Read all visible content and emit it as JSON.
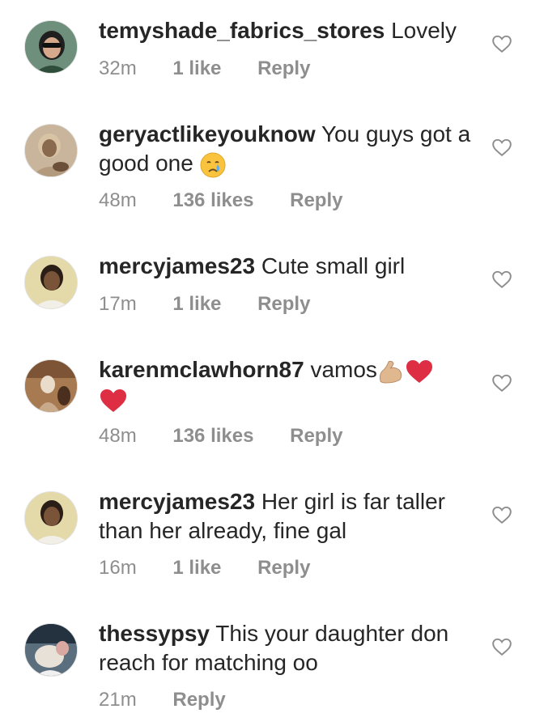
{
  "comments": [
    {
      "username": "temyshade_fabrics_stores",
      "text": "Lovely",
      "time": "32m",
      "likes": "1 like",
      "reply": "Reply",
      "colors": {
        "bg": "#6e8f7b",
        "face": "#d6a98c",
        "hair": "#1f1f1f"
      }
    },
    {
      "username": "geryactlikeyouknow",
      "text": "You guys got a good one",
      "emoji": "crying-face",
      "time": "48m",
      "likes": "136 likes",
      "reply": "Reply",
      "colors": {
        "bg": "#c9b59c",
        "face": "#8a6a4f",
        "hair": "#d8c3a5"
      }
    },
    {
      "username": "mercyjames23",
      "text": "Cute small girl",
      "time": "17m",
      "likes": "1 like",
      "reply": "Reply",
      "colors": {
        "bg": "#e4d9a8",
        "face": "#7a5438",
        "hair": "#2b1e16"
      }
    },
    {
      "username": "karenmclawhorn87",
      "text": "vamos",
      "emoji": "flexed-biceps heart heart",
      "time": "48m",
      "likes": "136 likes",
      "reply": "Reply",
      "colors": {
        "bg": "#a77a52",
        "face": "#e9dccb",
        "hair": "#4a2e1e"
      }
    },
    {
      "username": "mercyjames23",
      "text": "Her girl is far taller than her already, fine gal",
      "time": "16m",
      "likes": "1 like",
      "reply": "Reply",
      "colors": {
        "bg": "#e4d9a8",
        "face": "#7a5438",
        "hair": "#2b1e16"
      }
    },
    {
      "username": "thessypsy",
      "text": "This your daughter don reach for matching oo",
      "time": "21m",
      "likes": "",
      "reply": "Reply",
      "colors": {
        "bg": "#5b6e7d",
        "face": "#e8e1d8",
        "hair": "#243240"
      }
    }
  ],
  "like_icon": "heart-outline-icon",
  "colors": {
    "text": "#262626",
    "meta": "#8e8e8e",
    "heart_emoji": "#dd2e44",
    "biceps": "#e0b890"
  }
}
